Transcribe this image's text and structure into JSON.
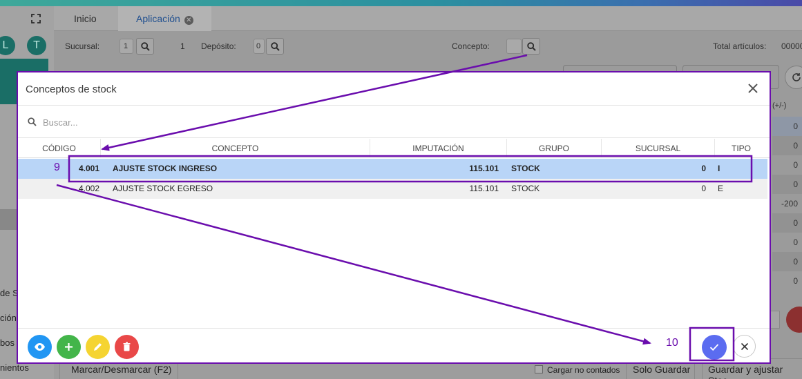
{
  "tabs": {
    "home": "Inicio",
    "app": "Aplicación"
  },
  "sidebar": {
    "letter1": "L",
    "letter2": "T",
    "texts": [
      "de S",
      "ción",
      "bos",
      "nientos"
    ]
  },
  "filters": {
    "branch_label": "Sucursal:",
    "branch_value": "1",
    "branch_name": "1",
    "deposit_label": "Depósito:",
    "deposit_value": "0",
    "concept_label": "Concepto:",
    "total_label": "Total artículos:",
    "total_value": "00000"
  },
  "background_grid": {
    "header": "(+/-)",
    "values": [
      "0",
      "0",
      "0",
      "0",
      "-200",
      "0",
      "0",
      "0",
      "0"
    ]
  },
  "bottom_bar": {
    "mark": "Marcar/Desmarcar (F2)",
    "load_uncounted": "Cargar no contados",
    "save_only": "Solo Guardar",
    "save_adjust": "Guardar y ajustar Stoc"
  },
  "dialog": {
    "title": "Conceptos de stock",
    "search_placeholder": "Buscar...",
    "columns": [
      "CÓDIGO",
      "CONCEPTO",
      "IMPUTACIÓN",
      "GRUPO",
      "SUCURSAL",
      "TIPO"
    ],
    "rows": [
      {
        "codigo": "4.001",
        "concepto": "AJUSTE STOCK INGRESO",
        "imputacion": "115.101",
        "grupo": "STOCK",
        "sucursal": "0",
        "tipo": "I"
      },
      {
        "codigo": "4.002",
        "concepto": "AJUSTE STOCK EGRESO",
        "imputacion": "115.101",
        "grupo": "STOCK",
        "sucursal": "0",
        "tipo": "E"
      }
    ]
  },
  "annotations": {
    "step9": "9",
    "step10": "10"
  },
  "colors": {
    "annotation": "#6a0dad",
    "selected_row": "#b9d5f7",
    "view_button": "#2196f3",
    "add_button": "#43b54a",
    "edit_button": "#f5d431",
    "delete_button": "#e94848",
    "confirm_button": "#5b6cf0"
  },
  "icons": [
    "fullscreen-icon",
    "close-circle-icon",
    "search-icon",
    "close-icon",
    "eye-icon",
    "plus-icon",
    "pencil-icon",
    "trash-icon",
    "check-icon",
    "refresh-icon"
  ]
}
